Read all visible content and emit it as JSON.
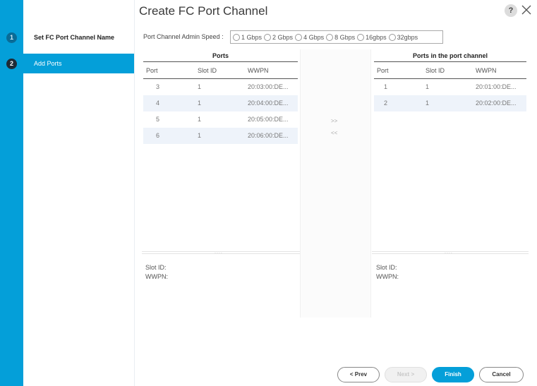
{
  "wizard": {
    "steps": [
      {
        "number": "1",
        "label": "Set FC Port Channel Name"
      },
      {
        "number": "2",
        "label": "Add Ports"
      }
    ]
  },
  "header": {
    "title": "Create FC Port Channel",
    "help_icon": "?",
    "close_icon": "close-icon"
  },
  "speed": {
    "label": "Port Channel Admin Speed :",
    "options": [
      "1 Gbps",
      "2 Gbps",
      "4 Gbps",
      "8 Gbps",
      "16gbps",
      "32gbps"
    ]
  },
  "ports_table": {
    "title": "Ports",
    "columns": [
      "Port",
      "Slot ID",
      "WWPN"
    ],
    "rows": [
      {
        "port": "3",
        "slot": "1",
        "wwpn": "20:03:00:DE..."
      },
      {
        "port": "4",
        "slot": "1",
        "wwpn": "20:04:00:DE..."
      },
      {
        "port": "5",
        "slot": "1",
        "wwpn": "20:05:00:DE..."
      },
      {
        "port": "6",
        "slot": "1",
        "wwpn": "20:06:00:DE..."
      }
    ]
  },
  "channel_table": {
    "title": "Ports in the port channel",
    "columns": [
      "Port",
      "Slot ID",
      "WWPN"
    ],
    "rows": [
      {
        "port": "1",
        "slot": "1",
        "wwpn": "20:01:00:DE..."
      },
      {
        "port": "2",
        "slot": "1",
        "wwpn": "20:02:00:DE..."
      }
    ]
  },
  "move": {
    "add": ">>",
    "remove": "<<"
  },
  "splitter_grip": "....",
  "details_left": {
    "slot_label": "Slot ID:",
    "wwpn_label": "WWPN:"
  },
  "details_right": {
    "slot_label": "Slot ID:",
    "wwpn_label": "WWPN:"
  },
  "footer": {
    "prev": "< Prev",
    "next": "Next >",
    "finish": "Finish",
    "cancel": "Cancel"
  },
  "colors": {
    "accent": "#049fd9",
    "active_step": "#1f2a36"
  }
}
